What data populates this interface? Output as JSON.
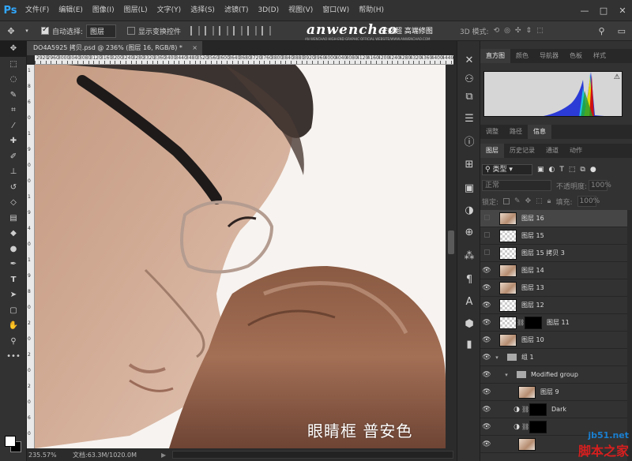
{
  "app": {
    "logo": "Ps",
    "menu": [
      "文件(F)",
      "编辑(E)",
      "图像(I)",
      "图层(L)",
      "文字(Y)",
      "选择(S)",
      "滤镜(T)",
      "3D(D)",
      "视图(V)",
      "窗口(W)",
      "帮助(H)"
    ],
    "window_controls": {
      "minimize": "—",
      "maximize": "□",
      "close": "✕"
    }
  },
  "options": {
    "auto_select_label": "自动选择:",
    "auto_select_target": "图层",
    "show_transform_label": "显示变换控件",
    "mode_3d_label": "3D 模式:"
  },
  "brand": {
    "logo_text": "anwenchao",
    "cn_text": "安文超 高端修图",
    "tagline": "AN WENCHAO HIGH-END GRAPHIC OFFICIAL WEBSITE/WWW.ANWENCHAO.COM"
  },
  "document": {
    "tab_title": "DO4A5925 拷贝.psd @ 236% (图层 16, RGB/8) *",
    "close": "×",
    "caption": "眼睛框 普安色"
  },
  "ruler": {
    "h_labels": [
      "2920",
      "2960",
      "3000",
      "3040",
      "3080",
      "3120",
      "3160",
      "3200",
      "3240",
      "3280",
      "3320",
      "3360",
      "3400",
      "3440",
      "3480",
      "3520",
      "3560",
      "3600",
      "3640",
      "3680",
      "3720",
      "3760",
      "3800",
      "3840",
      "3880",
      "3920",
      "3960",
      "4000",
      "4040",
      "4080",
      "4120",
      "4160",
      "4200",
      "4240",
      "4280",
      "4320",
      "4360",
      "4400",
      "4440",
      "4480"
    ],
    "v_labels": [
      "1",
      "8",
      "6",
      "0",
      "1",
      "9",
      "0",
      "0",
      "1",
      "9",
      "4",
      "0",
      "1",
      "9",
      "8",
      "0",
      "2",
      "0",
      "2",
      "0",
      "2",
      "0",
      "6",
      "0"
    ]
  },
  "status": {
    "zoom": "235.57%",
    "doc": "文档:63.3M/1020.0M",
    "arrow": "▶"
  },
  "panels": {
    "top_tabs": [
      "直方图",
      "颜色",
      "导航器",
      "色板",
      "样式"
    ],
    "mid_tabs": [
      "调整",
      "路径",
      "信息"
    ],
    "layer_tabs": [
      "图层",
      "历史记录",
      "通道",
      "动作"
    ],
    "filter_kind": "类型",
    "blend_mode": "正常",
    "opacity_label": "不透明度:",
    "opacity_value": "100%",
    "lock_label": "锁定:",
    "fill_label": "填充:",
    "fill_value": "100%",
    "histogram_warning": "⚠"
  },
  "layers": [
    {
      "name": "图层 16",
      "visible": false,
      "selected": true,
      "thumb": "photo"
    },
    {
      "name": "图层 15",
      "visible": false,
      "selected": false,
      "thumb": "checker"
    },
    {
      "name": "图层 15 拷贝 3",
      "visible": false,
      "selected": false,
      "thumb": "checker"
    },
    {
      "name": "图层 14",
      "visible": true,
      "selected": false,
      "thumb": "photo"
    },
    {
      "name": "图层 13",
      "visible": true,
      "selected": false,
      "thumb": "photo"
    },
    {
      "name": "图层 12",
      "visible": true,
      "selected": false,
      "thumb": "checker"
    },
    {
      "name": "图层 11",
      "visible": true,
      "selected": false,
      "thumb": "checker",
      "mask": true
    },
    {
      "name": "图层 10",
      "visible": true,
      "selected": false,
      "thumb": "photo"
    },
    {
      "name": "组 1",
      "visible": true,
      "selected": false,
      "group": true
    },
    {
      "name": "Modified group",
      "visible": true,
      "selected": false,
      "group": true,
      "indent": 1
    },
    {
      "name": "图层 9",
      "visible": true,
      "selected": false,
      "thumb": "photo",
      "indent": 2
    },
    {
      "name": "Dark",
      "visible": true,
      "selected": false,
      "adjustment": true,
      "indent": 2
    },
    {
      "name": "",
      "visible": true,
      "selected": false,
      "adjustment": true,
      "indent": 2
    },
    {
      "name": "",
      "visible": true,
      "selected": false,
      "thumb": "photo",
      "indent": 2
    }
  ],
  "watermark": {
    "line1": "jb51.net",
    "line2": "脚本之家"
  }
}
